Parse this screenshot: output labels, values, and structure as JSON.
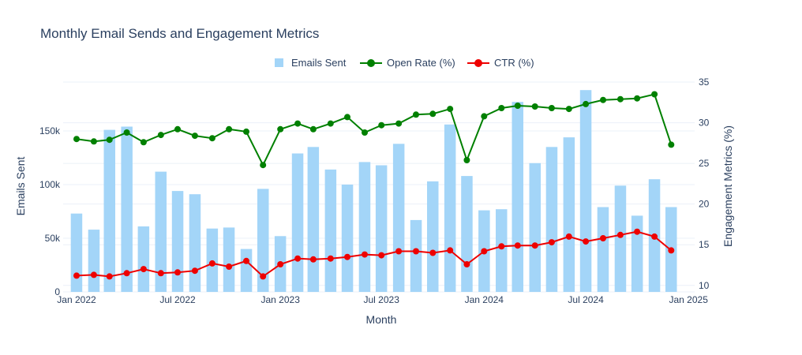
{
  "chart_data": {
    "type": "bar+line",
    "title": "Monthly Email Sends and Engagement Metrics",
    "xlabel": "Month",
    "ylabel_left": "Emails Sent",
    "ylabel_right": "Engagement Metrics (%)",
    "x_ticks": [
      "Jan 2022",
      "Jul 2022",
      "Jan 2023",
      "Jul 2023",
      "Jan 2024",
      "Jul 2024",
      "Jan 2025"
    ],
    "y_left_ticks": [
      "0",
      "50k",
      "100k",
      "150k"
    ],
    "y_right_ticks": [
      "10",
      "15",
      "20",
      "25",
      "30",
      "35"
    ],
    "y_left_range": [
      0,
      197000
    ],
    "y_right_range": [
      9.2,
      35.2
    ],
    "grid": true,
    "legend_position": "top-center",
    "months": [
      "2022-01",
      "2022-02",
      "2022-03",
      "2022-04",
      "2022-05",
      "2022-06",
      "2022-07",
      "2022-08",
      "2022-09",
      "2022-10",
      "2022-11",
      "2022-12",
      "2023-01",
      "2023-02",
      "2023-03",
      "2023-04",
      "2023-05",
      "2023-06",
      "2023-07",
      "2023-08",
      "2023-09",
      "2023-10",
      "2023-11",
      "2023-12",
      "2024-01",
      "2024-02",
      "2024-03",
      "2024-04",
      "2024-05",
      "2024-06",
      "2024-07",
      "2024-08",
      "2024-09",
      "2024-10",
      "2024-11",
      "2024-12"
    ],
    "series": [
      {
        "name": "Emails Sent",
        "type": "bar",
        "color": "#a3d5f8",
        "values": [
          73000,
          58000,
          151000,
          154000,
          61000,
          112000,
          94000,
          91000,
          59000,
          60000,
          40000,
          96000,
          52000,
          129000,
          135000,
          114000,
          100000,
          121000,
          118000,
          138000,
          67000,
          103000,
          156000,
          108000,
          76000,
          77000,
          177000,
          120000,
          135000,
          144000,
          188000,
          79000,
          99000,
          71000,
          105000,
          79000
        ]
      },
      {
        "name": "Open Rate (%)",
        "type": "line",
        "color": "#008000",
        "values": [
          28.0,
          27.7,
          27.9,
          28.8,
          27.6,
          28.5,
          29.2,
          28.4,
          28.1,
          29.2,
          28.9,
          24.8,
          29.2,
          29.9,
          29.2,
          29.9,
          30.7,
          28.8,
          29.7,
          29.9,
          31.0,
          31.1,
          31.7,
          25.4,
          30.8,
          31.8,
          32.1,
          32.0,
          31.8,
          31.7,
          32.3,
          32.8,
          32.9,
          33.0,
          33.5,
          27.3
        ]
      },
      {
        "name": "CTR (%)",
        "type": "line",
        "color": "#ee0000",
        "values": [
          11.2,
          11.3,
          11.1,
          11.5,
          12.0,
          11.5,
          11.6,
          11.8,
          12.7,
          12.3,
          13.0,
          11.1,
          12.6,
          13.3,
          13.2,
          13.3,
          13.5,
          13.8,
          13.7,
          14.2,
          14.2,
          14.0,
          14.3,
          12.6,
          14.2,
          14.8,
          14.9,
          14.9,
          15.3,
          16.0,
          15.4,
          15.8,
          16.2,
          16.6,
          16.0,
          14.3
        ]
      }
    ]
  }
}
